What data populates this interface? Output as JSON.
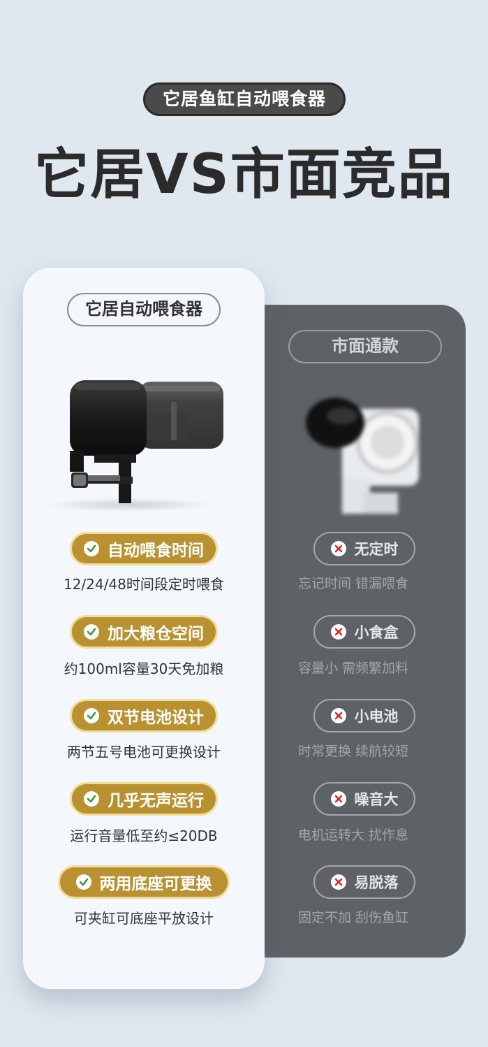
{
  "top_pill": "它居鱼缸自动喂食器",
  "headline": "它居VS市面竞品",
  "left_card": {
    "title": "它居自动喂食器",
    "features": [
      {
        "label": "自动喂食时间",
        "desc": "12/24/48时间段定时喂食"
      },
      {
        "label": "加大粮仓空间",
        "desc": "约100ml容量30天免加粮"
      },
      {
        "label": "双节电池设计",
        "desc": "两节五号电池可更换设计"
      },
      {
        "label": "几乎无声运行",
        "desc": "运行音量低至约≤20DB"
      },
      {
        "label": "两用底座可更换",
        "desc": "可夹缸可底座平放设计"
      }
    ]
  },
  "right_card": {
    "title": "市面通款",
    "features": [
      {
        "label": "无定时",
        "desc": "忘记时间 错漏喂食"
      },
      {
        "label": "小食盒",
        "desc": "容量小 需频繁加料"
      },
      {
        "label": "小电池",
        "desc": "时常更换 续航较短"
      },
      {
        "label": "噪音大",
        "desc": "电机运转大 扰作息"
      },
      {
        "label": "易脱落",
        "desc": "固定不加 刮伤鱼缸"
      }
    ]
  },
  "colors": {
    "background": "#dfe7ef",
    "gold": "#b99130",
    "dark_card": "#5e6266",
    "check": "#3b9a3b",
    "cross": "#d62828"
  },
  "icons": {
    "good": "check-icon",
    "bad": "cross-icon"
  }
}
